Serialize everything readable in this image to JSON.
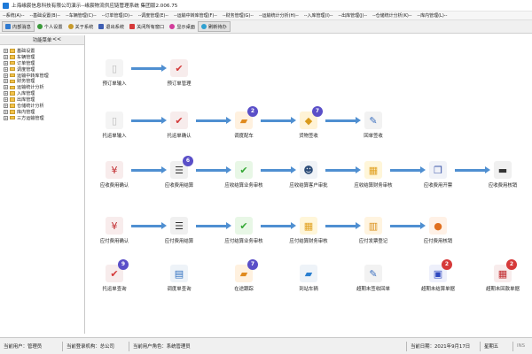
{
  "window": {
    "title": "上海缘宸信息科技有限公司演示--缘宸物流供应链管理系统 集团版2.006.75"
  },
  "menu": [
    "--系统(A)--",
    "--基础设置(B)--",
    "--车辆管理(C)--",
    "--订单管理(D)--",
    "--调度管理(E)--",
    "--运输中转库管理(F)--",
    "--财务管理(G)--",
    "--运输统计分析(H)--",
    "--入库管理(I)--",
    "--出库管理(J)--",
    "--仓储统计分析(K)--",
    "--库内管理(L)--"
  ],
  "toolbar": [
    {
      "label": "内部消息",
      "icon": "message-icon",
      "color": "#2f7ad0"
    },
    {
      "label": "个人设置",
      "icon": "person-icon",
      "color": "#3a9a3a"
    },
    {
      "label": "关于系统",
      "icon": "info-icon",
      "color": "#c79a2b"
    },
    {
      "label": "退出系统",
      "icon": "exit-icon",
      "color": "#3f5fb3"
    },
    {
      "label": "关闭所有窗口",
      "icon": "close-all-icon",
      "color": "#d63a3a"
    },
    {
      "label": "显示桌面",
      "icon": "desktop-icon",
      "color": "#d23a9a"
    },
    {
      "label": "刷新待办",
      "icon": "refresh-icon",
      "color": "#2fa0d0"
    }
  ],
  "sidebar": {
    "title": "功能菜单",
    "collapse": "<<",
    "items": [
      "基础设置",
      "车辆管理",
      "订单管理",
      "调度管理",
      "运输中转库管理",
      "财务管理",
      "运输统计分析",
      "入库管理",
      "出库管理",
      "仓储统计分析",
      "库内管理",
      "三方运输管理"
    ]
  },
  "flow": {
    "nodes": [
      {
        "key": "yudingdan-luru",
        "label": "预订单输入",
        "icon": "document-icon",
        "glyph": "▯",
        "color": "#f4f4f4",
        "fg": "#bbbbbb"
      },
      {
        "key": "yudingdan-guanli",
        "label": "预订单管理",
        "icon": "checklist-icon",
        "glyph": "✔",
        "color": "#f7ecec",
        "fg": "#d43a3a"
      },
      {
        "key": "tuoyundan-luru",
        "label": "托运单输入",
        "icon": "document-icon",
        "glyph": "▯",
        "color": "#f4f4f4",
        "fg": "#bbbbbb"
      },
      {
        "key": "tuoyundan-queren",
        "label": "托运单确认",
        "icon": "checklist-icon",
        "glyph": "✔",
        "color": "#f7ecec",
        "fg": "#d43a3a"
      },
      {
        "key": "diaodu-peiche",
        "label": "调度配车",
        "icon": "truck-icon",
        "glyph": "▰",
        "color": "#fff1df",
        "fg": "#e08a1e",
        "badge": "2",
        "badge_color": "#5a4fc8"
      },
      {
        "key": "huowu-qianshou",
        "label": "货物签收",
        "icon": "package-icon",
        "glyph": "◆",
        "color": "#fff3d6",
        "fg": "#d99a1a",
        "badge": "7",
        "badge_color": "#5a4fc8"
      },
      {
        "key": "huidan-qianshou",
        "label": "回单签收",
        "icon": "signed-document-icon",
        "glyph": "✎",
        "color": "#f2f2f2",
        "fg": "#3a6fbf"
      },
      {
        "key": "yingshou-queren",
        "label": "应收费用确认",
        "icon": "yen-invoice-icon",
        "glyph": "¥",
        "color": "#f8ecec",
        "fg": "#c0282c"
      },
      {
        "key": "yingshou-jiesuan",
        "label": "应收费用结算",
        "icon": "list-document-icon",
        "glyph": "☰",
        "color": "#f0f0f0",
        "fg": "#333333",
        "badge": "6",
        "badge_color": "#5a4fc8"
      },
      {
        "key": "yingshou-yewu-shenhe",
        "label": "应收结算业务审核",
        "icon": "approve-icon",
        "glyph": "✔",
        "color": "#e8f7e6",
        "fg": "#35a835"
      },
      {
        "key": "yingshou-kehu-shenpi",
        "label": "应收结算客户审批",
        "icon": "customer-icon",
        "glyph": "☻",
        "color": "#f0f3f7",
        "fg": "#2c4c78"
      },
      {
        "key": "yingshou-caiwu-shenhe",
        "label": "应收结算财务审核",
        "icon": "calculator-icon",
        "glyph": "▦",
        "color": "#fff6d9",
        "fg": "#e0a020"
      },
      {
        "key": "yingshou-kaipiao",
        "label": "应收费用开票",
        "icon": "invoice-icon",
        "glyph": "❐",
        "color": "#f0f2f8",
        "fg": "#3a55a8"
      },
      {
        "key": "yingshou-hexiao",
        "label": "应收费用核销",
        "icon": "card-icon",
        "glyph": "▬",
        "color": "#f0f0f0",
        "fg": "#333333"
      },
      {
        "key": "yingfu-queren",
        "label": "应付费用确认",
        "icon": "yen-invoice-icon",
        "glyph": "¥",
        "color": "#f8ecec",
        "fg": "#c0282c"
      },
      {
        "key": "yingfu-jiesuan",
        "label": "应付费用结算",
        "icon": "list-document-icon",
        "glyph": "☰",
        "color": "#f0f0f0",
        "fg": "#333333"
      },
      {
        "key": "yingfu-yewu-shenhe",
        "label": "应付结算业务审核",
        "icon": "approve-icon",
        "glyph": "✔",
        "color": "#e8f7e6",
        "fg": "#35a835"
      },
      {
        "key": "yingfu-caiwu-shenhe",
        "label": "应付结算财务审核",
        "icon": "calculator-icon",
        "glyph": "▦",
        "color": "#fff6d9",
        "fg": "#e0a020"
      },
      {
        "key": "yingfu-fapiao",
        "label": "应付发票登记",
        "icon": "barcode-icon",
        "glyph": "▥",
        "color": "#fff4e0",
        "fg": "#d9901a"
      },
      {
        "key": "yingfu-hexiao",
        "label": "应付费用核销",
        "icon": "coin-icon",
        "glyph": "●",
        "color": "#fff1e6",
        "fg": "#e07020"
      },
      {
        "key": "tuoyundan-chaxun",
        "label": "托运单查询",
        "icon": "checklist-icon",
        "glyph": "✔",
        "color": "#f7ecec",
        "fg": "#d43a3a",
        "badge": "9",
        "badge_color": "#5a4fc8"
      },
      {
        "key": "diaodudan-chaxun",
        "label": "调度单查询",
        "icon": "clipboard-icon",
        "glyph": "▤",
        "color": "#eef3f8",
        "fg": "#2f6fbf"
      },
      {
        "key": "zaitu-genzong",
        "label": "在途跟踪",
        "icon": "truck-icon",
        "glyph": "▰",
        "color": "#fff1df",
        "fg": "#e08a1e",
        "badge": "7",
        "badge_color": "#5a4fc8"
      },
      {
        "key": "daozhan-cheliang",
        "label": "到站车辆",
        "icon": "delivery-truck-icon",
        "glyph": "▰",
        "color": "#eef3f8",
        "fg": "#2a7fd0"
      },
      {
        "key": "chaoqi-huidan",
        "label": "超期未签收回单",
        "icon": "signed-document-icon",
        "glyph": "✎",
        "color": "#f2f2f2",
        "fg": "#3a6fbf"
      },
      {
        "key": "chaoqi-jiesuan",
        "label": "超期未结算单据",
        "icon": "document-lock-icon",
        "glyph": "▣",
        "color": "#eef0fb",
        "fg": "#2f48c0",
        "badge": "2",
        "badge_color": "#d63a3a"
      },
      {
        "key": "chaoqi-huikuan",
        "label": "超期未回款单据",
        "icon": "calculator-icon",
        "glyph": "▦",
        "color": "#f8ecec",
        "fg": "#c0282c",
        "badge": "2",
        "badge_color": "#d63a3a"
      }
    ]
  },
  "status": {
    "user": "当前用户：管理员",
    "org": "当前登录机构：总公司",
    "role": "当前用户角色：系统管理员",
    "date": "当前日期：2021年9月17日",
    "weekday": "星期五",
    "ins": "INS"
  }
}
